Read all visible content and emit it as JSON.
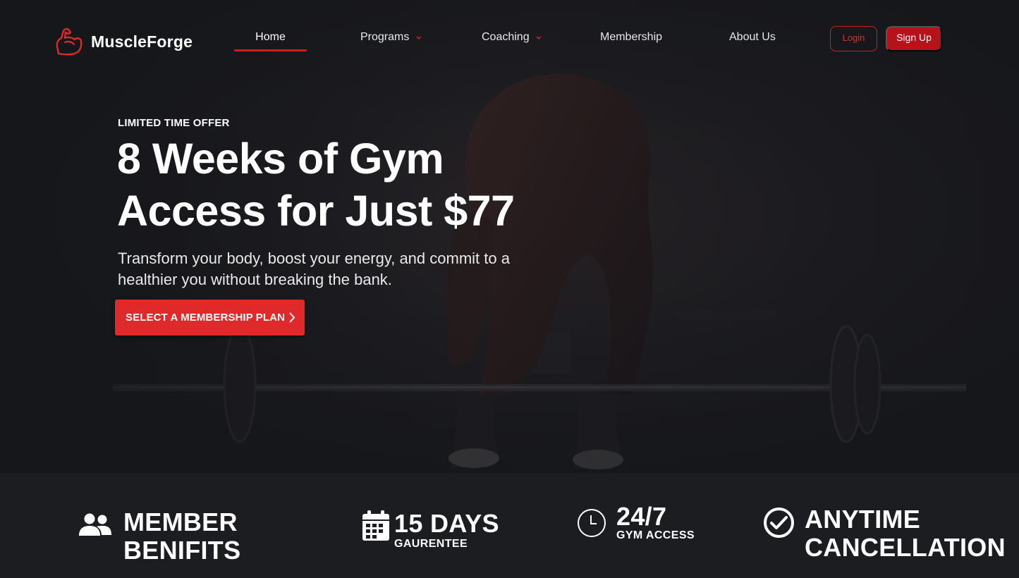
{
  "brand": {
    "name": "MuscleForge",
    "logo_icon": "flexed-arm-icon",
    "accent": "#e0292a"
  },
  "nav": {
    "items": [
      {
        "label": "Home",
        "active": true
      },
      {
        "label": "Programs",
        "has_dropdown": true
      },
      {
        "label": "Coaching",
        "has_dropdown": true
      },
      {
        "label": "Membership"
      },
      {
        "label": "About Us"
      }
    ],
    "login_label": "Login",
    "signup_label": "Sign Up"
  },
  "hero": {
    "eyebrow": "LIMITED TIME OFFER",
    "headline_line1": "8 Weeks of Gym",
    "headline_line2": "Access for Just $77",
    "subcopy": "Transform your body, boost your energy, and commit to a healthier you without breaking the bank.",
    "cta_label": "SELECT A MEMBERSHIP PLAN",
    "cta_icon": "chevron-right-icon"
  },
  "features": [
    {
      "icon": "users-icon",
      "line1": "MEMBER",
      "line2": "BENIFITS"
    },
    {
      "icon": "calendar-icon",
      "title": "15 DAYS",
      "subtitle": "GAURENTEE"
    },
    {
      "icon": "clock-icon",
      "title": "24/7",
      "subtitle": "GYM ACCESS"
    },
    {
      "icon": "check-circle-icon",
      "line1": "ANYTIME",
      "line2": "CANCELLATION"
    }
  ]
}
